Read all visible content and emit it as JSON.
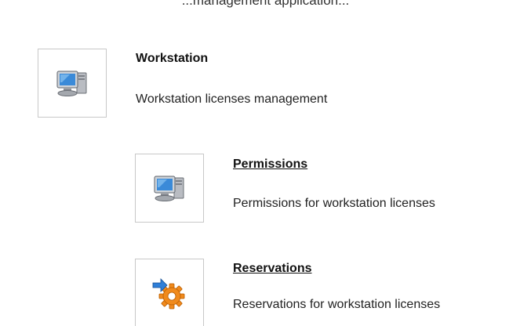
{
  "top_clip": "...management application...",
  "workstation": {
    "icon": "computer-icon",
    "title": "Workstation",
    "description": "Workstation licenses management"
  },
  "children": [
    {
      "id": "permissions",
      "icon": "computer-icon",
      "title": "Permissions",
      "description": "Permissions for workstation licenses"
    },
    {
      "id": "reservations",
      "icon": "gear-arrow-icon",
      "title": "Reservations",
      "description": "Reservations for workstation licenses"
    }
  ],
  "colors": {
    "monitor_blue": "#3a8ad8",
    "gear_orange": "#f08a1c",
    "arrow_blue": "#2f7fd8"
  }
}
